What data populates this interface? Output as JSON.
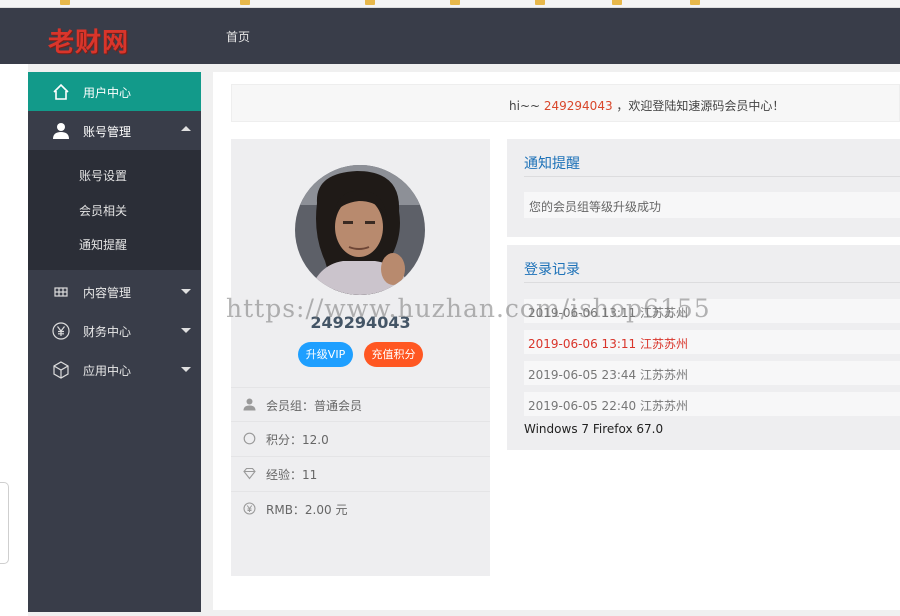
{
  "header": {
    "logo": "老财网",
    "nav_home": "首页"
  },
  "sidebar": {
    "user_center": "用户中心",
    "account_management": "账号管理",
    "sub_items": [
      "账号设置",
      "会员相关",
      "通知提醒"
    ],
    "content_management": "内容管理",
    "finance_center": "财务中心",
    "app_center": "应用中心"
  },
  "welcome": {
    "prefix": "hi~~ ",
    "user_id": "249294043",
    "suffix": " ，欢迎登陆知速源码会员中心！"
  },
  "profile": {
    "username": "249294043",
    "upgrade_vip_label": "升级VIP",
    "recharge_points_label": "充值积分",
    "member_group": "会员组：普通会员",
    "points": "积分：12.0",
    "experience": "经验：11",
    "rmb": "RMB：2.00 元"
  },
  "notice": {
    "title": "通知提醒",
    "item": "您的会员组等级升级成功"
  },
  "login_records": {
    "title": "登录记录",
    "rows": [
      "2019-06-06 13:11 江苏苏州",
      "2019-06-06 13:11 江苏苏州",
      "2019-06-05 23:44 江苏苏州",
      "2019-06-05 22:40 江苏苏州"
    ],
    "user_agent": "Windows 7 Firefox 67.0"
  },
  "watermark": "https://www.huzhan.com/ishop6155",
  "colors": {
    "header_bg": "#393d49",
    "sidebar_active": "#129a8a",
    "vip_button": "#1e9fff",
    "points_button": "#ff5722",
    "highlight_red": "#d9352b"
  }
}
